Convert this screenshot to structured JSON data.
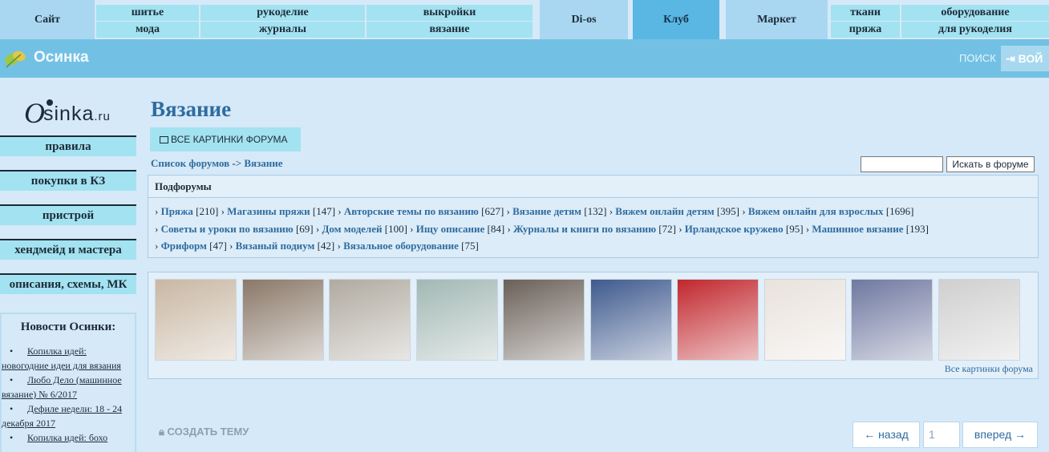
{
  "topnav": {
    "site": "Сайт",
    "grid1": [
      [
        "шитье",
        "мода"
      ],
      [
        "рукоделие",
        "журналы"
      ],
      [
        "выкройки",
        "вязание"
      ]
    ],
    "dios": "Di-os",
    "club": "Клуб",
    "market": "Маркет",
    "grid2": [
      [
        "ткани",
        "пряжа"
      ],
      [
        "оборудование",
        "для рукоделия"
      ]
    ]
  },
  "header": {
    "brand": "Осинка",
    "search": "ПОИСК",
    "login": "ВОЙ"
  },
  "sidebar": {
    "logo_o": "O",
    "logo_rest": "sinka",
    "logo_ru": ".ru",
    "buttons": [
      "правила",
      "покупки в КЗ",
      "пристрой",
      "хендмейд и мастера",
      "описания, схемы, МК"
    ],
    "news_title": "Новости Осинки:",
    "news": [
      {
        "lead": "Копилка идей:",
        "rest": "новогодние идеи для вязания"
      },
      {
        "lead": "Любо Дело (машинное",
        "rest": "вязание) № 6/2017"
      },
      {
        "lead": "Дефиле недели: 18 - 24",
        "rest": "декабря 2017"
      },
      {
        "lead": "Копилка идей: бохо",
        "rest": ""
      }
    ]
  },
  "main": {
    "title": "Вязание",
    "pics_button": "ВСЕ КАРТИНКИ ФОРУМА",
    "breadcrumb": {
      "root": "Список форумов",
      "sep": "->",
      "current": "Вязание"
    },
    "search_button": "Искать в форуме",
    "subforums_title": "Подфорумы",
    "subforums": [
      {
        "name": "Пряжа",
        "count": "[210]"
      },
      {
        "name": "Магазины пряжи",
        "count": "[147]"
      },
      {
        "name": "Авторские темы по вязанию",
        "count": "[627]"
      },
      {
        "name": "Вязание детям",
        "count": "[132]"
      },
      {
        "name": "Вяжем онлайн детям",
        "count": "[395]"
      },
      {
        "name": "Вяжем онлайн для взрослых",
        "count": "[1696]"
      },
      {
        "name": "Советы и уроки по вязанию",
        "count": "[69]"
      },
      {
        "name": "Дом моделей",
        "count": "[100]"
      },
      {
        "name": "Ищу описание",
        "count": "[84]"
      },
      {
        "name": "Журналы и книги по вязанию",
        "count": "[72]"
      },
      {
        "name": "Ирландское кружево",
        "count": "[95]"
      },
      {
        "name": "Машинное вязание",
        "count": "[193]"
      },
      {
        "name": "Фриформ",
        "count": "[47]"
      },
      {
        "name": "Вязаный подиум",
        "count": "[42]"
      },
      {
        "name": "Вязальное оборудование",
        "count": "[75]"
      }
    ],
    "all_pictures": "Все картинки форума",
    "create_topic": "СОЗДАТЬ ТЕМУ",
    "pager": {
      "prev": "← назад",
      "page": "1",
      "next": "вперед →"
    }
  },
  "thumbnail_colors": [
    "#c9b7a3",
    "#8a7868",
    "#b0aaa0",
    "#a2b8b4",
    "#6a6058",
    "#3f5a8e",
    "#c1272d",
    "#e9e2dc",
    "#6f78a0",
    "#d0cfcf"
  ]
}
